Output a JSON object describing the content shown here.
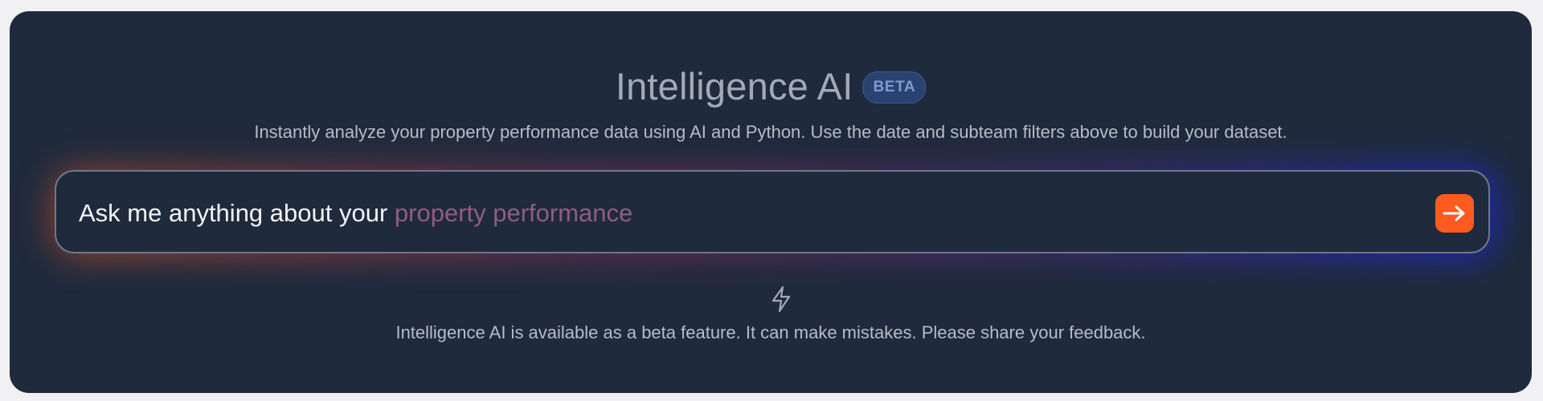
{
  "header": {
    "title": "Intelligence AI",
    "badge": "BETA",
    "subtitle": "Instantly analyze your property performance data using AI and Python. Use the date and subteam filters above to build your dataset."
  },
  "prompt": {
    "lead_text": "Ask me anything about your",
    "accent_text": "property performance",
    "send_icon": "arrow-right-icon"
  },
  "footer": {
    "icon": "lightning-bolt-icon",
    "note": "Intelligence AI is available as a beta feature. It can make mistakes. Please share your feedback."
  },
  "colors": {
    "panel_background": "#1f2a3c",
    "page_background": "#f1f1f3",
    "send_button": "#ff5a1f",
    "badge_background": "#2a4270",
    "badge_text": "#7d9bd2",
    "accent_text": "#8e5e7e"
  }
}
